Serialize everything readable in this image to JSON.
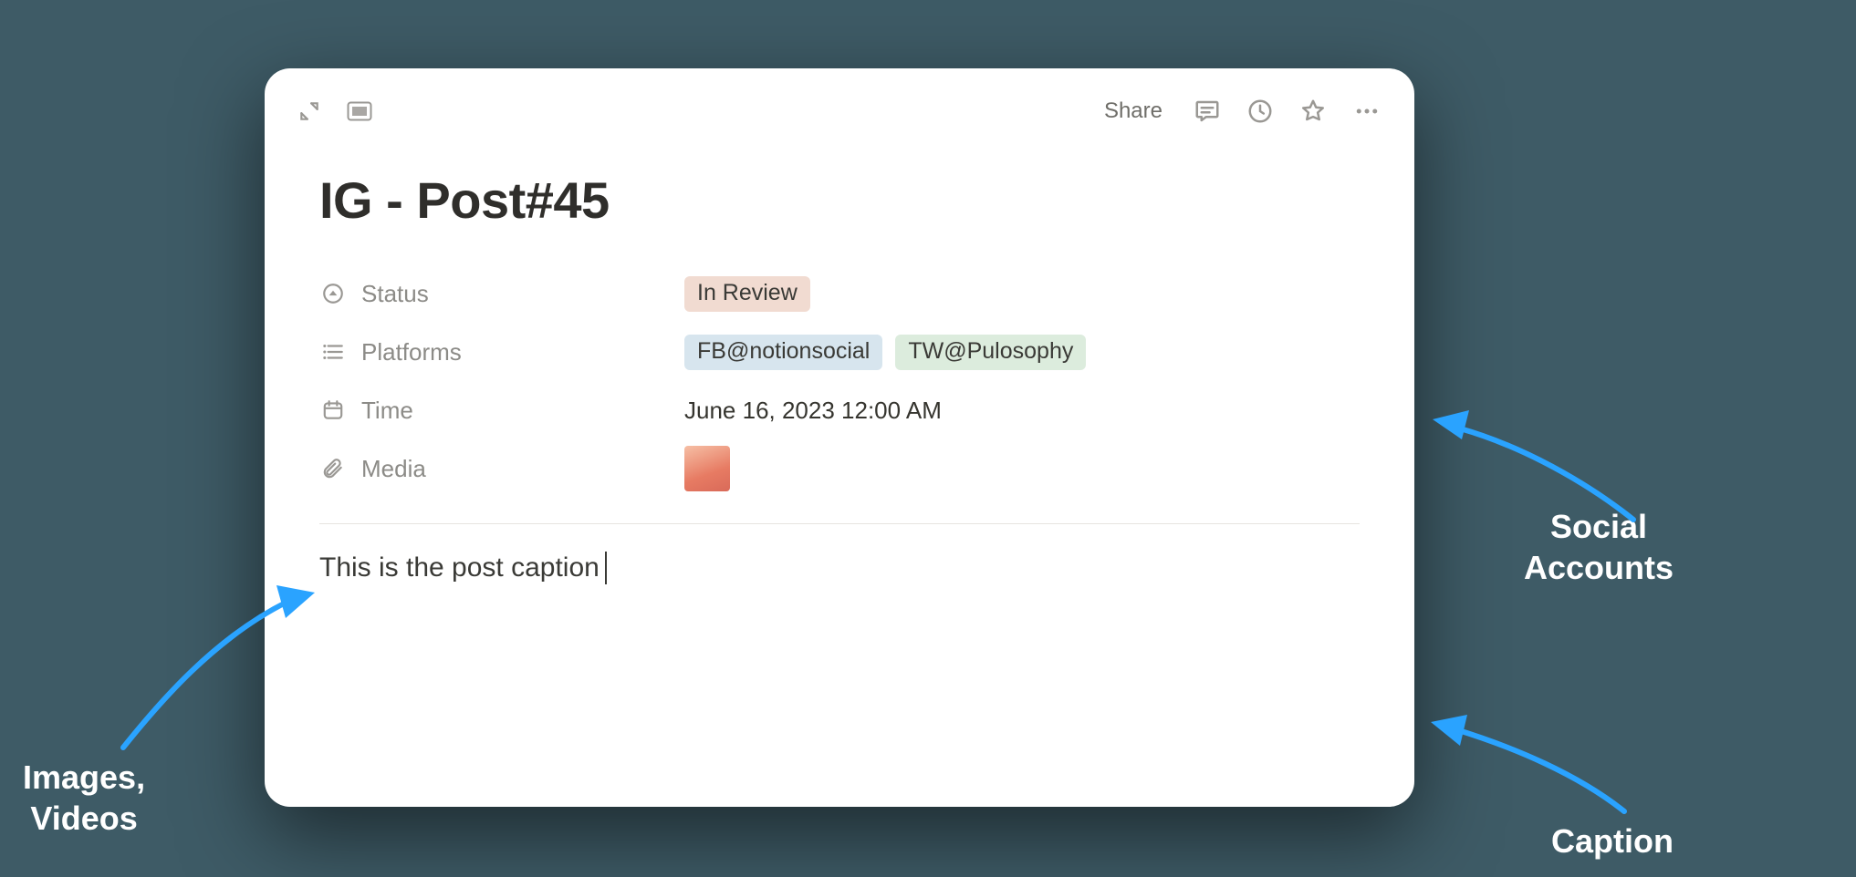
{
  "topbar": {
    "share_label": "Share"
  },
  "page": {
    "title": "IG - Post#45",
    "caption": "This is the post caption"
  },
  "props": {
    "status": {
      "label": "Status",
      "value": "In Review"
    },
    "platforms": {
      "label": "Platforms",
      "values": [
        "FB@notionsocial",
        "TW@Pulosophy"
      ]
    },
    "time": {
      "label": "Time",
      "value": "June 16, 2023 12:00 AM"
    },
    "media": {
      "label": "Media"
    }
  },
  "annotations": {
    "social": "Social\nAccounts",
    "caption": "Caption",
    "media": "Images,\nVideos"
  }
}
